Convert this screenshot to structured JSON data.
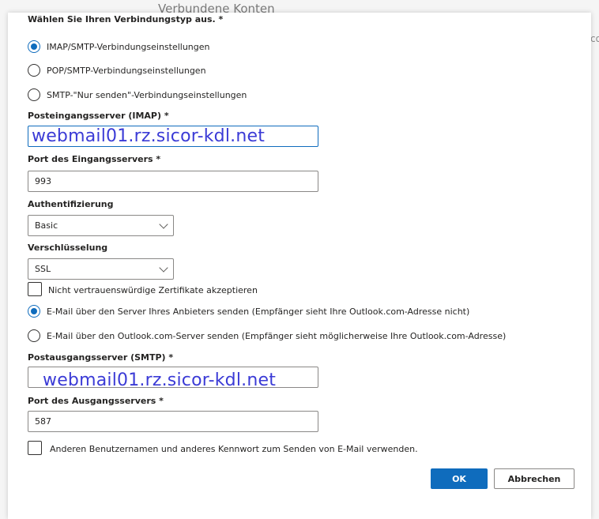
{
  "background": {
    "title": "Verbundene Konten",
    "cut_text": "co"
  },
  "connection": {
    "label": "Wählen Sie Ihren Verbindungstyp aus. *",
    "options": [
      "IMAP/SMTP-Verbindungseinstellungen",
      "POP/SMTP-Verbindungseinstellungen",
      "SMTP-\"Nur senden\"-Verbindungseinstellungen"
    ],
    "selected_index": 0
  },
  "incoming_server": {
    "label": "Posteingangsserver (IMAP) *",
    "value": "webmail01.rz.sicor-kdl.net"
  },
  "incoming_port": {
    "label": "Port des Eingangsservers *",
    "value": "993"
  },
  "authentication": {
    "label": "Authentifizierung",
    "value": "Basic"
  },
  "encryption": {
    "label": "Verschlüsselung",
    "value": "SSL"
  },
  "untrusted_cert": {
    "label": "Nicht vertrauenswürdige Zertifikate akzeptieren",
    "checked": false
  },
  "send_options": {
    "options": [
      "E-Mail über den Server Ihres Anbieters senden (Empfänger sieht Ihre Outlook.com-Adresse nicht)",
      "E-Mail über den Outlook.com-Server senden (Empfänger sieht möglicherweise Ihre Outlook.com-Adresse)"
    ],
    "selected_index": 0
  },
  "outgoing_server": {
    "label": "Postausgangsserver (SMTP) *",
    "value": "webmail01.rz.sicor-kdl.net"
  },
  "outgoing_port": {
    "label": "Port des Ausgangsservers *",
    "value": "587"
  },
  "alt_credentials": {
    "label": "Anderen Benutzernamen und anderes Kennwort zum Senden von E-Mail verwenden.",
    "checked": false
  },
  "buttons": {
    "ok": "OK",
    "cancel": "Abbrechen"
  },
  "colors": {
    "accent": "#0f6cbd",
    "overlay_text": "#3b3bd6"
  }
}
